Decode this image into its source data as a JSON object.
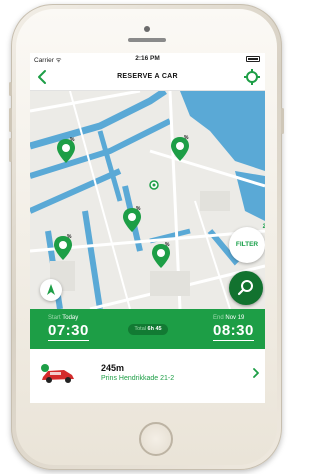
{
  "status_bar": {
    "carrier": "Carrier ᯤ",
    "time": "2:16 PM"
  },
  "nav": {
    "title": "RESERVE A CAR",
    "back_icon": "chevron-left-icon",
    "locate_icon": "locate-icon"
  },
  "map": {
    "pins": [
      {
        "count": "%"
      },
      {
        "count": "%"
      },
      {
        "count": "%"
      },
      {
        "count": "%"
      },
      {
        "count": "%"
      }
    ],
    "filter": {
      "label": "FILTER",
      "badge": "2"
    }
  },
  "time_bar": {
    "start": {
      "label": "Start",
      "day": "Today",
      "time": "07:30"
    },
    "total": {
      "label": "Total",
      "value": "6h 45"
    },
    "end": {
      "label": "End",
      "day": "Nov 19",
      "time": "08:30"
    }
  },
  "car": {
    "distance": "245m",
    "address": "Prins Hendrikkade 21-2"
  },
  "colors": {
    "accent": "#1d9e46",
    "accent_dark": "#12722f",
    "water": "#5aa9d6"
  }
}
